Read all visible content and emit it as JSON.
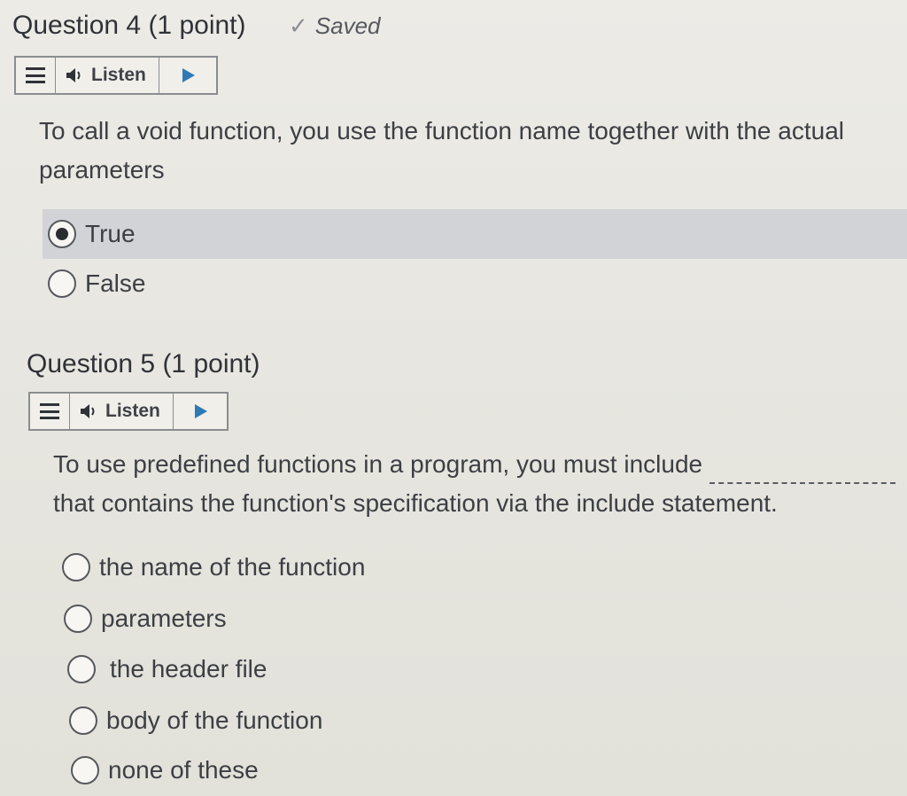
{
  "q4": {
    "title_num": "Question 4",
    "title_pts": "(1 point)",
    "saved_label": "Saved",
    "listen_label": "Listen",
    "text_line1": "To call a void function, you use the function name together with the actual",
    "text_line2": "parameters",
    "options": [
      "True",
      "False"
    ],
    "selected": "True"
  },
  "q5": {
    "title_num": "Question 5",
    "title_pts": "(1 point)",
    "listen_label": "Listen",
    "text_line1": "To use predefined functions in a program, you must include",
    "text_line2": "that contains the function's specification via the include statement.",
    "options": [
      "the name of the function",
      "parameters",
      "the header file",
      "body of the function",
      "none of these"
    ]
  },
  "colors": {
    "play": "#2f7ab5",
    "highlight": "#d2d3d6"
  }
}
